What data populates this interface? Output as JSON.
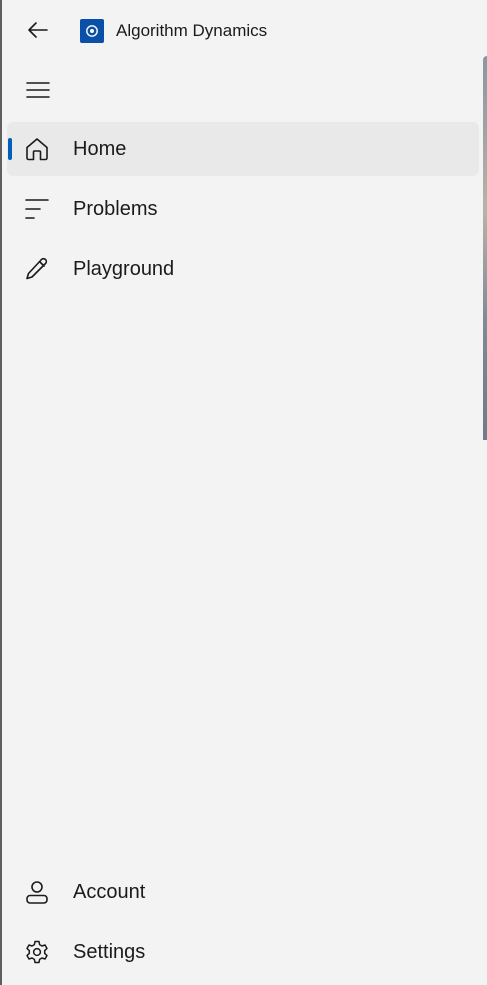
{
  "window": {
    "title": "Algorithm Dynamics"
  },
  "titlebar": {
    "back_icon": "back-arrow-icon",
    "app_icon": "app-logo-icon"
  },
  "nav": {
    "menu_icon": "hamburger-menu-icon",
    "items": [
      {
        "label": "Home",
        "icon": "home-icon",
        "selected": true
      },
      {
        "label": "Problems",
        "icon": "list-icon",
        "selected": false
      },
      {
        "label": "Playground",
        "icon": "pencil-icon",
        "selected": false
      }
    ],
    "footer_items": [
      {
        "label": "Account",
        "icon": "person-icon"
      },
      {
        "label": "Settings",
        "icon": "gear-icon"
      }
    ]
  },
  "colors": {
    "accent": "#005fb8",
    "app_icon_bg": "#0a4fa8",
    "pane_bg": "#f3f3f3",
    "selected_bg": "#e9e9e9"
  }
}
